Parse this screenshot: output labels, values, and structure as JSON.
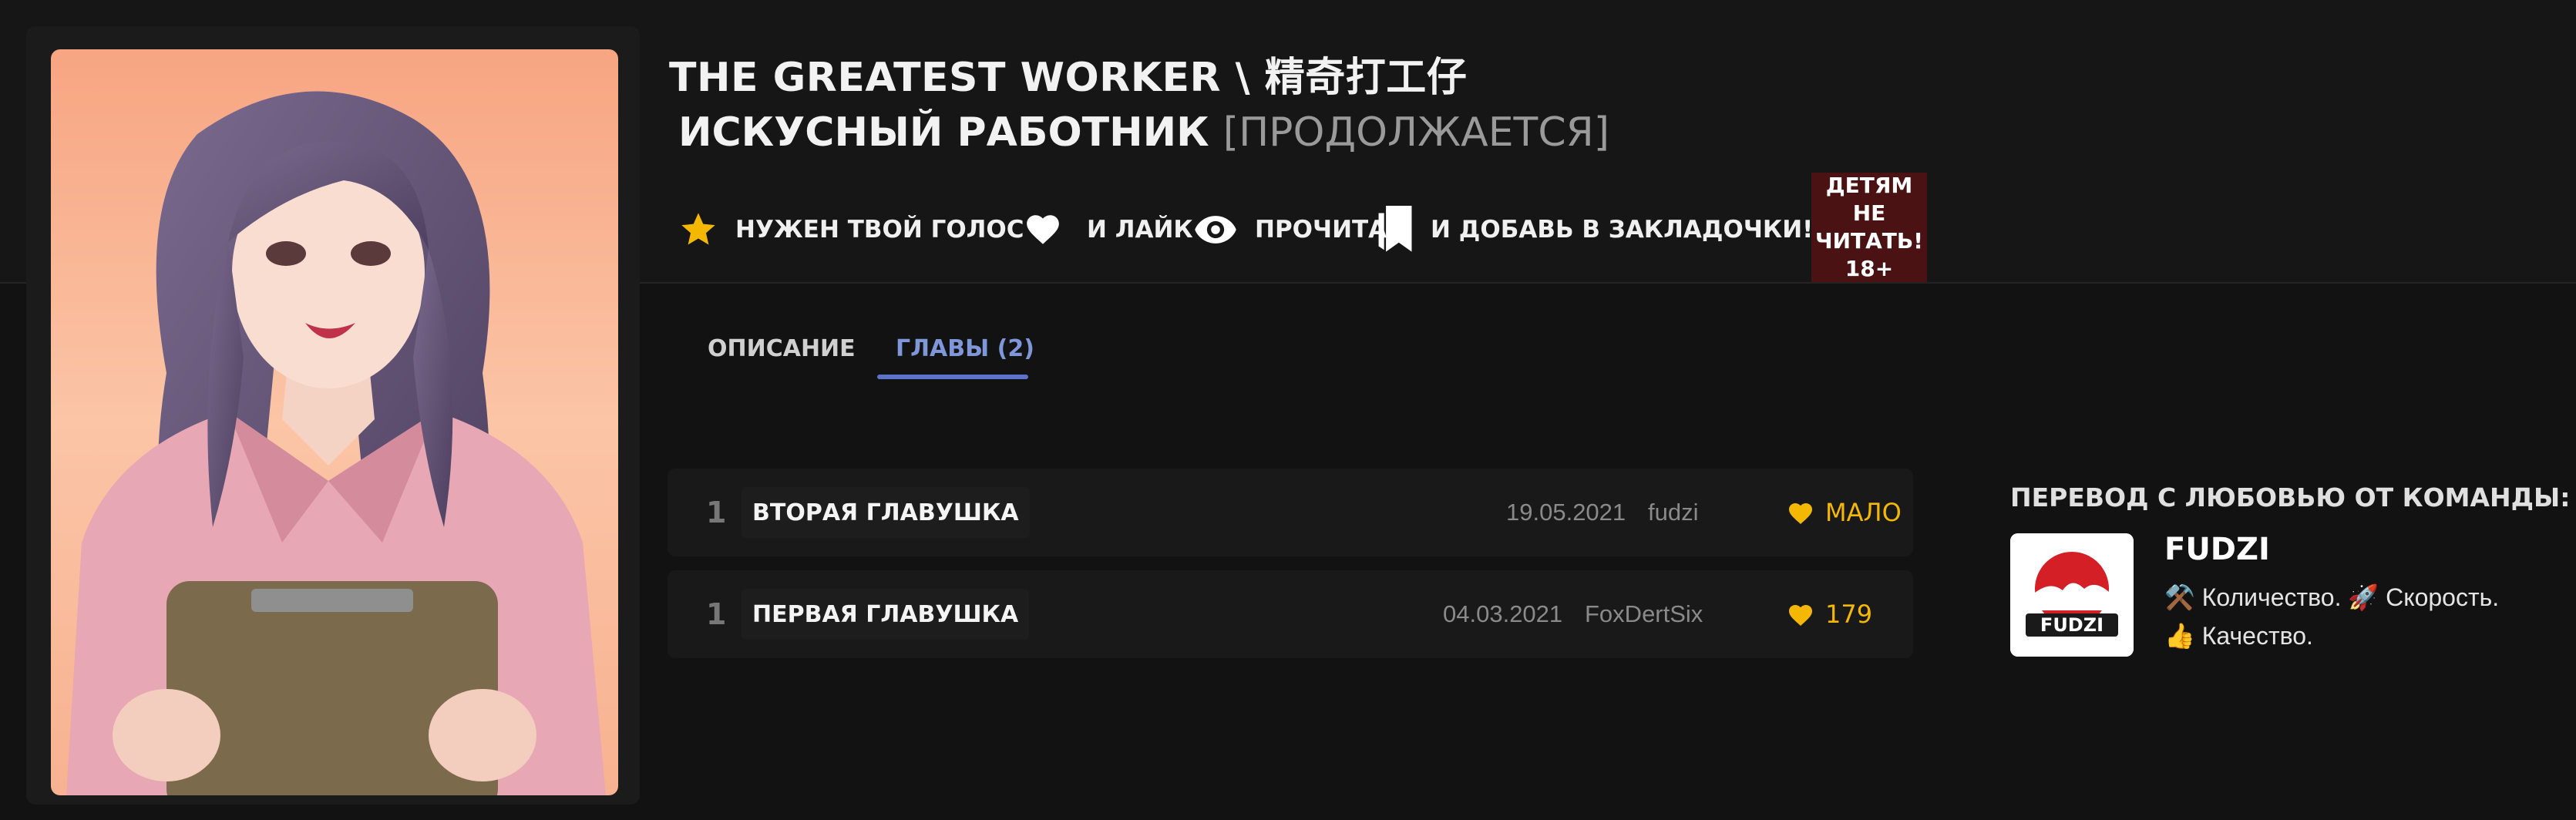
{
  "manga": {
    "title_line1": "THE GREATEST WORKER \\ 精奇打工仔",
    "title_line2": "ИСКУСНЫЙ РАБОТНИК",
    "status": "[ПРОДОЛЖАЕТСЯ]",
    "cover_icon": "cover-art"
  },
  "actions": {
    "vote_label": "НУЖЕН ТВОЙ ГОЛОС",
    "like_label": "И ЛАЙК",
    "read_label": "ПРОЧИТАЙ",
    "bookmark_label": "И ДОБАВЬ В ЗАКЛАДОЧКИ!",
    "icons": [
      "star-icon",
      "heart-icon",
      "eye-icon",
      "bookmark-icon"
    ]
  },
  "age_badge": {
    "line1": "ДЕТЯМ НЕ",
    "line2": "ЧИТАТЬ!",
    "line3": "18+"
  },
  "tabs": [
    {
      "label": "ОПИСАНИЕ",
      "active": false
    },
    {
      "label": "ГЛАВЫ (2)",
      "active": true
    }
  ],
  "chapters": [
    {
      "number": "1",
      "title": "ВТОРАЯ ГЛАВУШКА",
      "date": "19.05.2021",
      "translator": "fudzi",
      "likes": "МАЛО"
    },
    {
      "number": "1",
      "title": "ПЕРВАЯ ГЛАВУШКА",
      "date": "04.03.2021",
      "translator": "FoxDertSix",
      "likes": "179"
    }
  ],
  "team": {
    "heading": "ПЕРЕВОД С ЛЮБОВЬЮ ОТ КОМАНДЫ:",
    "name": "FUDZI",
    "logo_text": "FUDZI",
    "desc_line1": "⚒️ Количество. 🚀 Скорость.",
    "desc_line2": "👍 Качество."
  },
  "colors": {
    "background": "#121212",
    "accent": "#5b74c9",
    "likes": "#f5b800",
    "age_badge": "#4a1212"
  }
}
